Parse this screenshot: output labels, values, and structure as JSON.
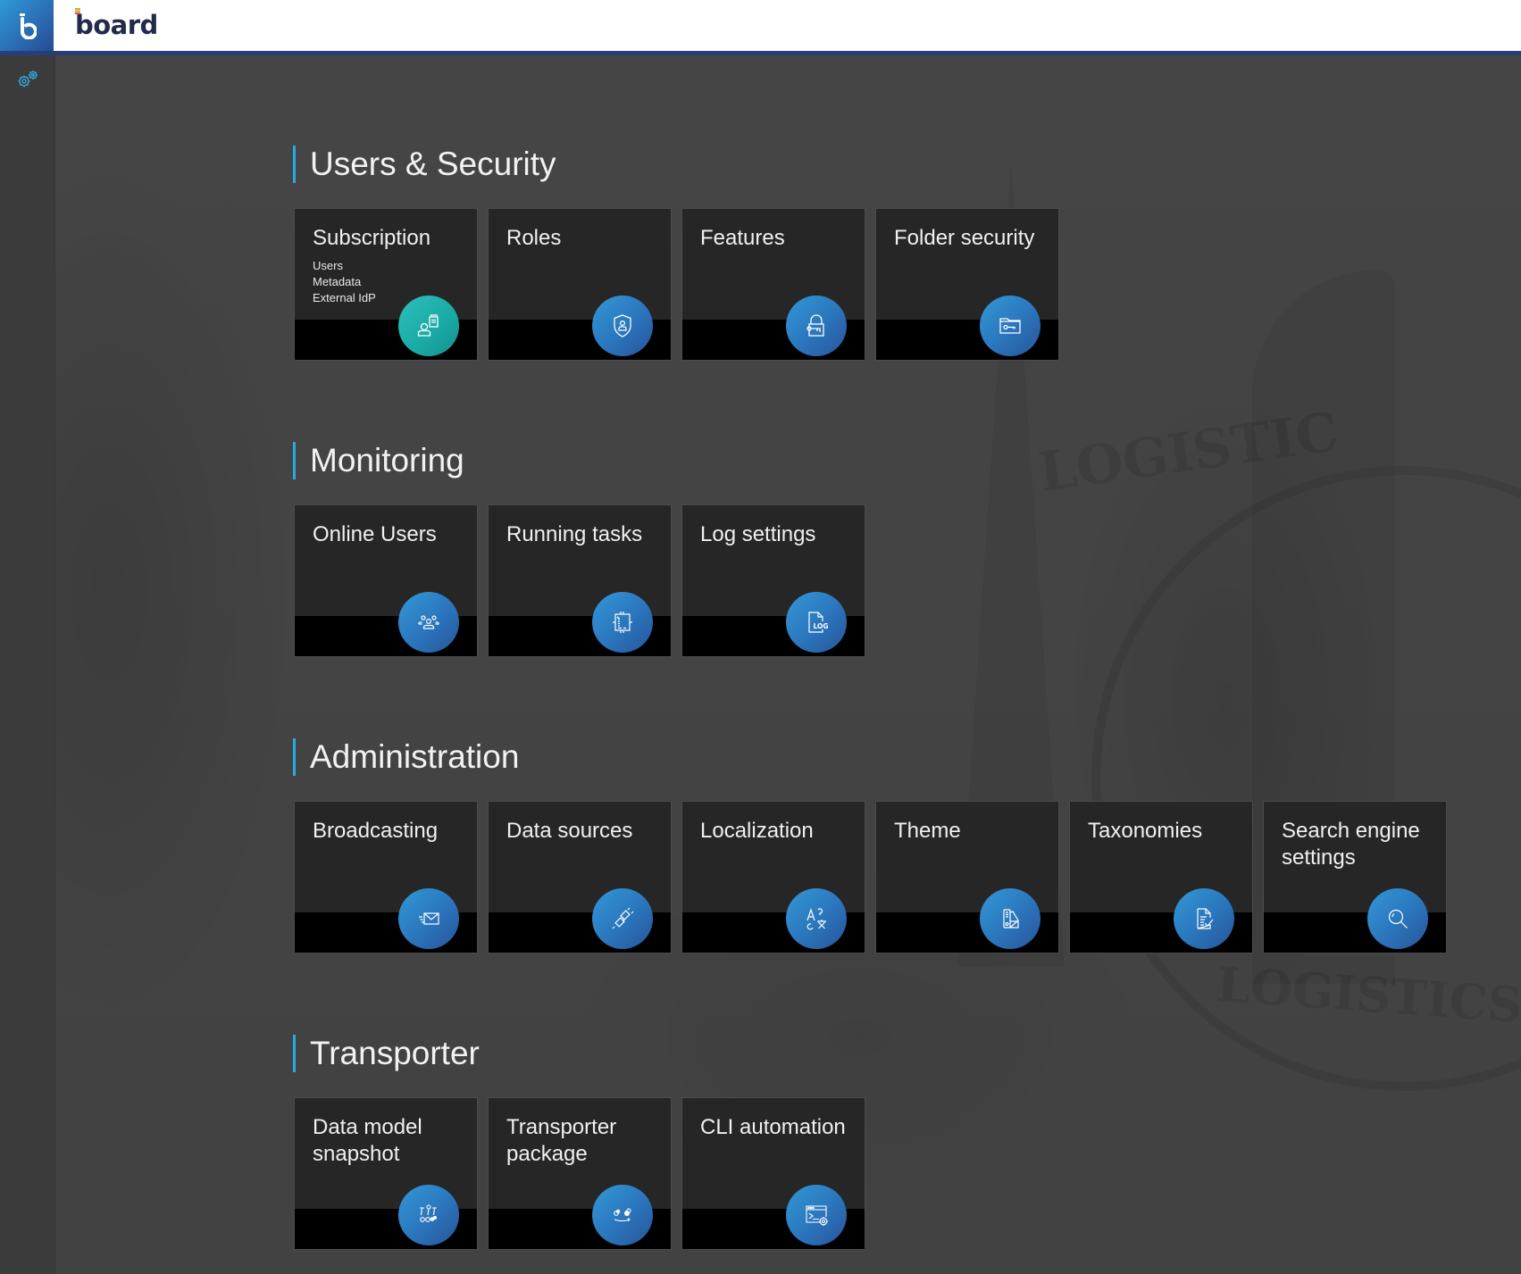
{
  "header": {
    "logo_letter": "b",
    "brand": "board"
  },
  "sidebar": {
    "items": [
      {
        "name": "settings",
        "icon": "gears-icon"
      }
    ]
  },
  "colors": {
    "accent": "#29a9e1",
    "header_line": "#263e7a",
    "tile_bg": "#262626",
    "icon_blue": "#2b78bf",
    "icon_teal": "#1aa9a4",
    "background": "#464646"
  },
  "sections": [
    {
      "title": "Users & Security",
      "tiles": [
        {
          "title": "Subscription",
          "subitems": [
            "Users",
            "Metadata",
            "External IdP"
          ],
          "icon": "user-document-icon",
          "color": "teal"
        },
        {
          "title": "Roles",
          "icon": "shield-user-icon",
          "color": "blue"
        },
        {
          "title": "Features",
          "icon": "lock-key-icon",
          "color": "blue"
        },
        {
          "title": "Folder security",
          "icon": "folder-key-icon",
          "color": "blue"
        }
      ]
    },
    {
      "title": "Monitoring",
      "tiles": [
        {
          "title": "Online Users",
          "icon": "users-group-icon",
          "color": "blue"
        },
        {
          "title": "Running tasks",
          "icon": "task-chip-icon",
          "color": "blue"
        },
        {
          "title": "Log settings",
          "icon": "log-file-icon",
          "color": "blue",
          "icon_text": "LOG"
        }
      ]
    },
    {
      "title": "Administration",
      "tiles": [
        {
          "title": "Broadcasting",
          "icon": "envelope-send-icon",
          "color": "blue"
        },
        {
          "title": "Data sources",
          "icon": "plug-connector-icon",
          "color": "blue"
        },
        {
          "title": "Localization",
          "icon": "translate-icon",
          "color": "blue"
        },
        {
          "title": "Theme",
          "icon": "palette-swatch-icon",
          "color": "blue"
        },
        {
          "title": "Taxonomies",
          "icon": "document-check-icon",
          "color": "blue"
        },
        {
          "title": "Search engine settings",
          "icon": "magnifier-icon",
          "color": "blue"
        }
      ]
    },
    {
      "title": "Transporter",
      "tiles": [
        {
          "title": "Data model snapshot",
          "icon": "snapshot-nodes-icon",
          "color": "blue"
        },
        {
          "title": "Transporter package",
          "icon": "transport-arrow-icon",
          "color": "blue"
        },
        {
          "title": "CLI automation",
          "icon": "terminal-gear-icon",
          "color": "blue"
        }
      ]
    }
  ]
}
